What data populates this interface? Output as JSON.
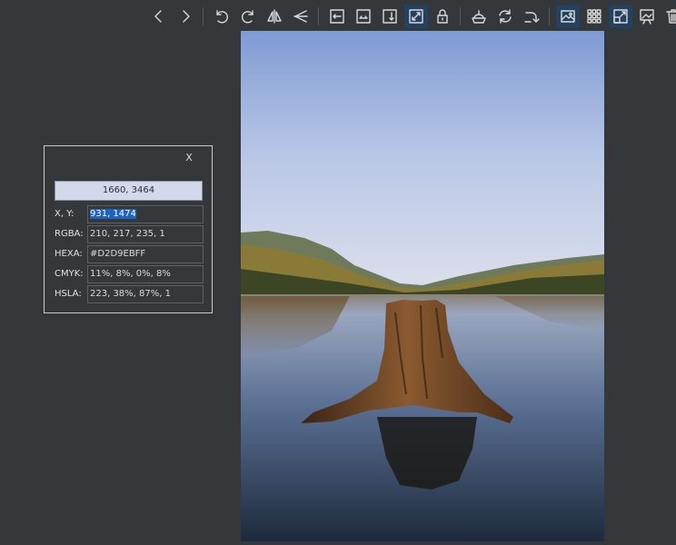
{
  "toolbar": {
    "icons": [
      "chevron-left-icon",
      "chevron-right-icon",
      "rotate-left-icon",
      "rotate-right-icon",
      "flip-horizontal-icon",
      "flip-vertical-icon",
      "fit-width-icon",
      "fit-height-icon",
      "fit-both-icon",
      "auto-zoom-icon",
      "lock-icon",
      "cloud-icon",
      "refresh-icon",
      "redo-icon",
      "image-icon",
      "grid-icon",
      "fullscreen-icon",
      "slideshow-icon",
      "trash-icon"
    ],
    "active_color": "#24415f"
  },
  "picker": {
    "close_label": "X",
    "preview_value": "1660, 3464",
    "preview_color": "#D2D9EB",
    "rows": [
      {
        "label": "X, Y:",
        "value": "931, 1474"
      },
      {
        "label": "RGBA:",
        "value": "210, 217, 235, 1"
      },
      {
        "label": "HEXA:",
        "value": "#D2D9EBFF"
      },
      {
        "label": "CMYK:",
        "value": "11%, 8%, 0%, 8%"
      },
      {
        "label": "HSLA:",
        "value": "223, 38%, 87%, 1"
      }
    ]
  }
}
